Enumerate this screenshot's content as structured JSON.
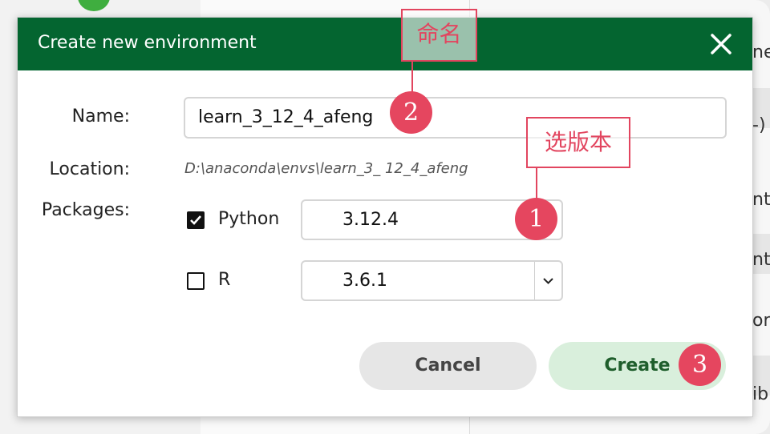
{
  "dialog": {
    "title": "Create new environment",
    "close_icon": "close-icon"
  },
  "form": {
    "name_label": "Name:",
    "name_value": "learn_3_12_4_afeng",
    "location_label": "Location:",
    "location_value": "D:\\anaconda\\envs\\learn_3_ 12_4_afeng",
    "packages_label": "Packages:",
    "packages": [
      {
        "name": "Python",
        "checked": true,
        "version": "3.12.4"
      },
      {
        "name": "R",
        "checked": false,
        "version": "3.6.1"
      }
    ]
  },
  "buttons": {
    "cancel": "Cancel",
    "create": "Create"
  },
  "annotations": {
    "rename": "命名",
    "choose_version": "选版本",
    "step1": "1",
    "step2": "2",
    "step3": "3"
  },
  "background": {
    "right_texts": [
      "ne",
      "-)",
      "nt",
      "nt",
      "or",
      "ib"
    ]
  },
  "colors": {
    "header_green": "#046530",
    "annotation_red": "#e2455f",
    "create_bg": "#d9efdc",
    "cancel_bg": "#e6e6e6"
  }
}
